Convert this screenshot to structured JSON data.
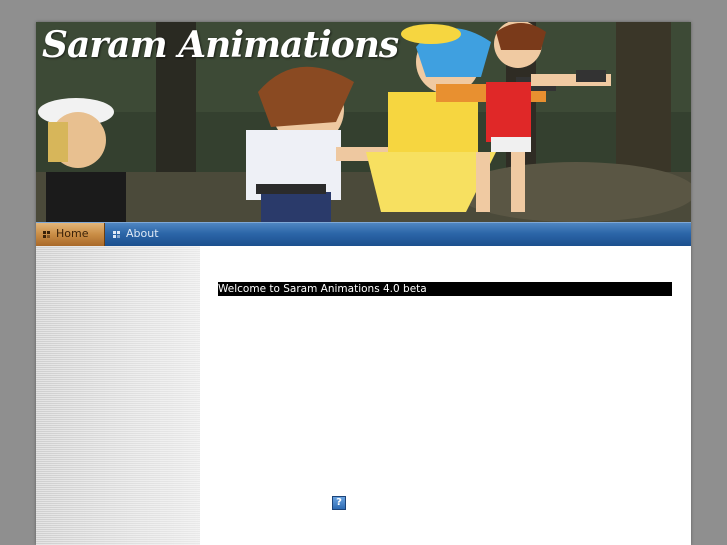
{
  "site": {
    "title": "Saram Animations"
  },
  "nav": {
    "items": [
      {
        "label": "Home",
        "active": true
      },
      {
        "label": "About",
        "active": false
      }
    ]
  },
  "main": {
    "welcome_text": "Welcome to Saram Animations 4.0 beta",
    "help_icon_glyph": "?"
  },
  "colors": {
    "navbar": "#2c66a8",
    "active_tab": "#c98d45",
    "background": "#8f8f8f"
  }
}
